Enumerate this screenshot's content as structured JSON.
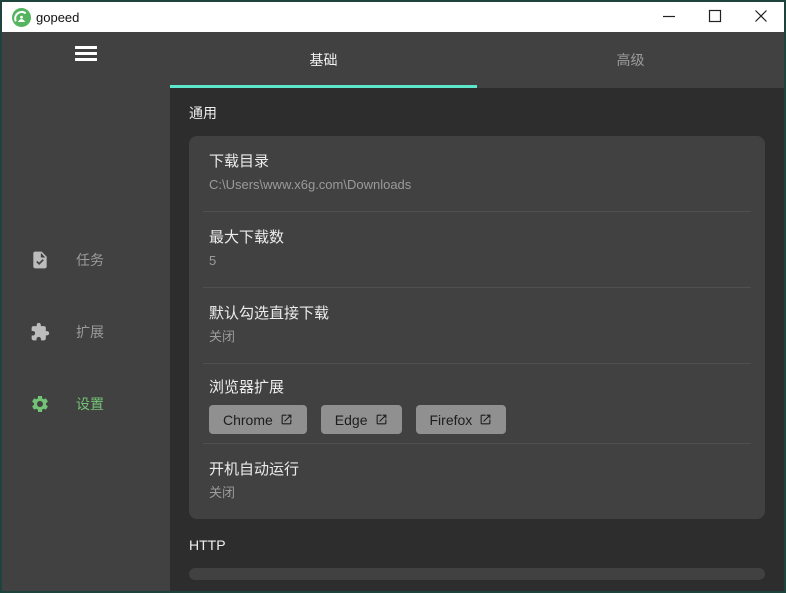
{
  "window": {
    "title": "gopeed"
  },
  "sidebar": {
    "items": [
      {
        "id": "tasks",
        "label": "任务",
        "icon": "task-file-icon",
        "active": false
      },
      {
        "id": "extensions",
        "label": "扩展",
        "icon": "puzzle-icon",
        "active": false
      },
      {
        "id": "settings",
        "label": "设置",
        "icon": "gear-icon",
        "active": true
      }
    ]
  },
  "tabs": {
    "basic": "基础",
    "advanced": "高级",
    "active": "basic"
  },
  "general": {
    "heading": "通用",
    "rows": [
      {
        "title": "下载目录",
        "value": "C:\\Users\\www.x6g.com\\Downloads"
      },
      {
        "title": "最大下载数",
        "value": "5"
      },
      {
        "title": "默认勾选直接下载",
        "value": "关闭"
      },
      {
        "title": "浏览器扩展",
        "buttons": [
          {
            "label": "Chrome"
          },
          {
            "label": "Edge"
          },
          {
            "label": "Firefox"
          }
        ]
      },
      {
        "title": "开机自动运行",
        "value": "关闭"
      }
    ]
  },
  "http": {
    "heading": "HTTP"
  },
  "icons": {
    "minimize": "─",
    "maximize": "□",
    "close": "✕",
    "external_link": "open-in-new"
  },
  "colors": {
    "accent_teal": "#5de6ca",
    "accent_green": "#72c377",
    "logo_green": "#54b45f",
    "panel": "#414141",
    "background": "#2d2d2d",
    "titlebar": "#ffffff",
    "muted_text": "#9b9b9b"
  }
}
